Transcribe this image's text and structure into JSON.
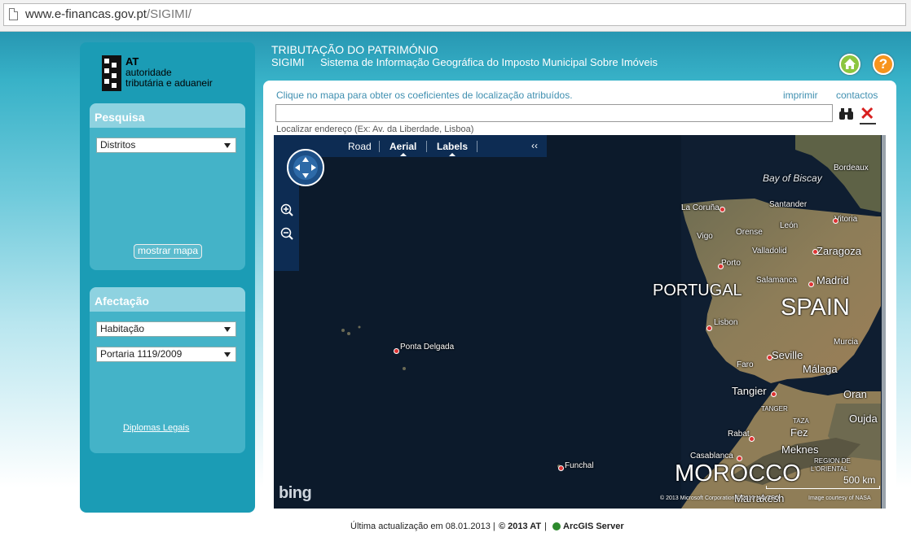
{
  "browser": {
    "url_domain": "www.e-financas.gov.pt",
    "url_path": "/SIGIMI/"
  },
  "header": {
    "title": "TRIBUTAÇÃO DO PATRIMÓNIO",
    "app_name": "SIGIMI",
    "app_desc": "Sistema de Informação Geográfica do Imposto Municipal Sobre Imóveis",
    "help_label": "?"
  },
  "logo": {
    "at": "AT",
    "line1": "autoridade",
    "line2": "tributária e aduaneir"
  },
  "pesquisa": {
    "title": "Pesquisa",
    "select_value": "Distritos",
    "button_label": "mostrar mapa"
  },
  "afectacao": {
    "title": "Afectação",
    "select1_value": "Habitação",
    "select2_value": "Portaria 1119/2009",
    "link_label": "Diplomas Legais"
  },
  "main": {
    "instruction": "Clique no mapa para obter os coeficientes de localização atribuídos.",
    "print_label": "imprimir",
    "contacts_label": "contactos",
    "address_value": "",
    "address_hint": "Localizar endereço (Ex: Av. da Liberdade, Lisboa)",
    "clear_label": "✕"
  },
  "map": {
    "nav": {
      "road": "Road",
      "aerial": "Aerial",
      "labels": "Labels",
      "collapse": "‹‹"
    },
    "labels": {
      "bay_of_biscay": "Bay of Biscay",
      "bordeaux": "Bordeaux",
      "la_coruna": "La Coruña",
      "santander": "Santander",
      "vitoria": "Vitoria",
      "leon": "León",
      "vigo": "Vigo",
      "orense": "Orense",
      "valladolid": "Valladolid",
      "zaragoza": "Zaragoza",
      "porto": "Porto",
      "portugal": "PORTUGAL",
      "salamanca": "Salamanca",
      "madrid": "Madrid",
      "spain": "SPAIN",
      "lisbon": "Lisbon",
      "murcia": "Murcia",
      "ponta_delgada": "Ponta Delgada",
      "seville": "Seville",
      "faro": "Faro",
      "malaga": "Málaga",
      "tangier": "Tangier",
      "oran": "Oran",
      "tanger": "TANGER",
      "taza": "TAZA",
      "oujda": "Oujda",
      "rabat": "Rabat",
      "fez": "Fez",
      "casablanca": "Casablanca",
      "meknes": "Meknes",
      "region_de": "REGION DE",
      "l_oriental": "L'ORIENTAL",
      "funchal": "Funchal",
      "morocco": "MOROCCO",
      "marrakesh": "Marrakesh"
    },
    "bing": "bing",
    "scale": "500 km",
    "copyright_left": "© 2013 Microsoft Corporation  © 2010 NAVTEQ",
    "copyright_right": "Image courtesy of NASA"
  },
  "footer": {
    "updated": "Última actualização em 08.01.2013 |",
    "copyright": "© 2013 AT",
    "sep": "|",
    "arcgis": "ArcGIS  Server"
  },
  "colors": {
    "band": "#38b2c8",
    "sidebar": "#1b9cb5",
    "panel": "#44b3c8",
    "panel_head": "#8ed2e0",
    "link": "#3f8fb0",
    "home": "#8cc63f",
    "help": "#f7941d"
  }
}
